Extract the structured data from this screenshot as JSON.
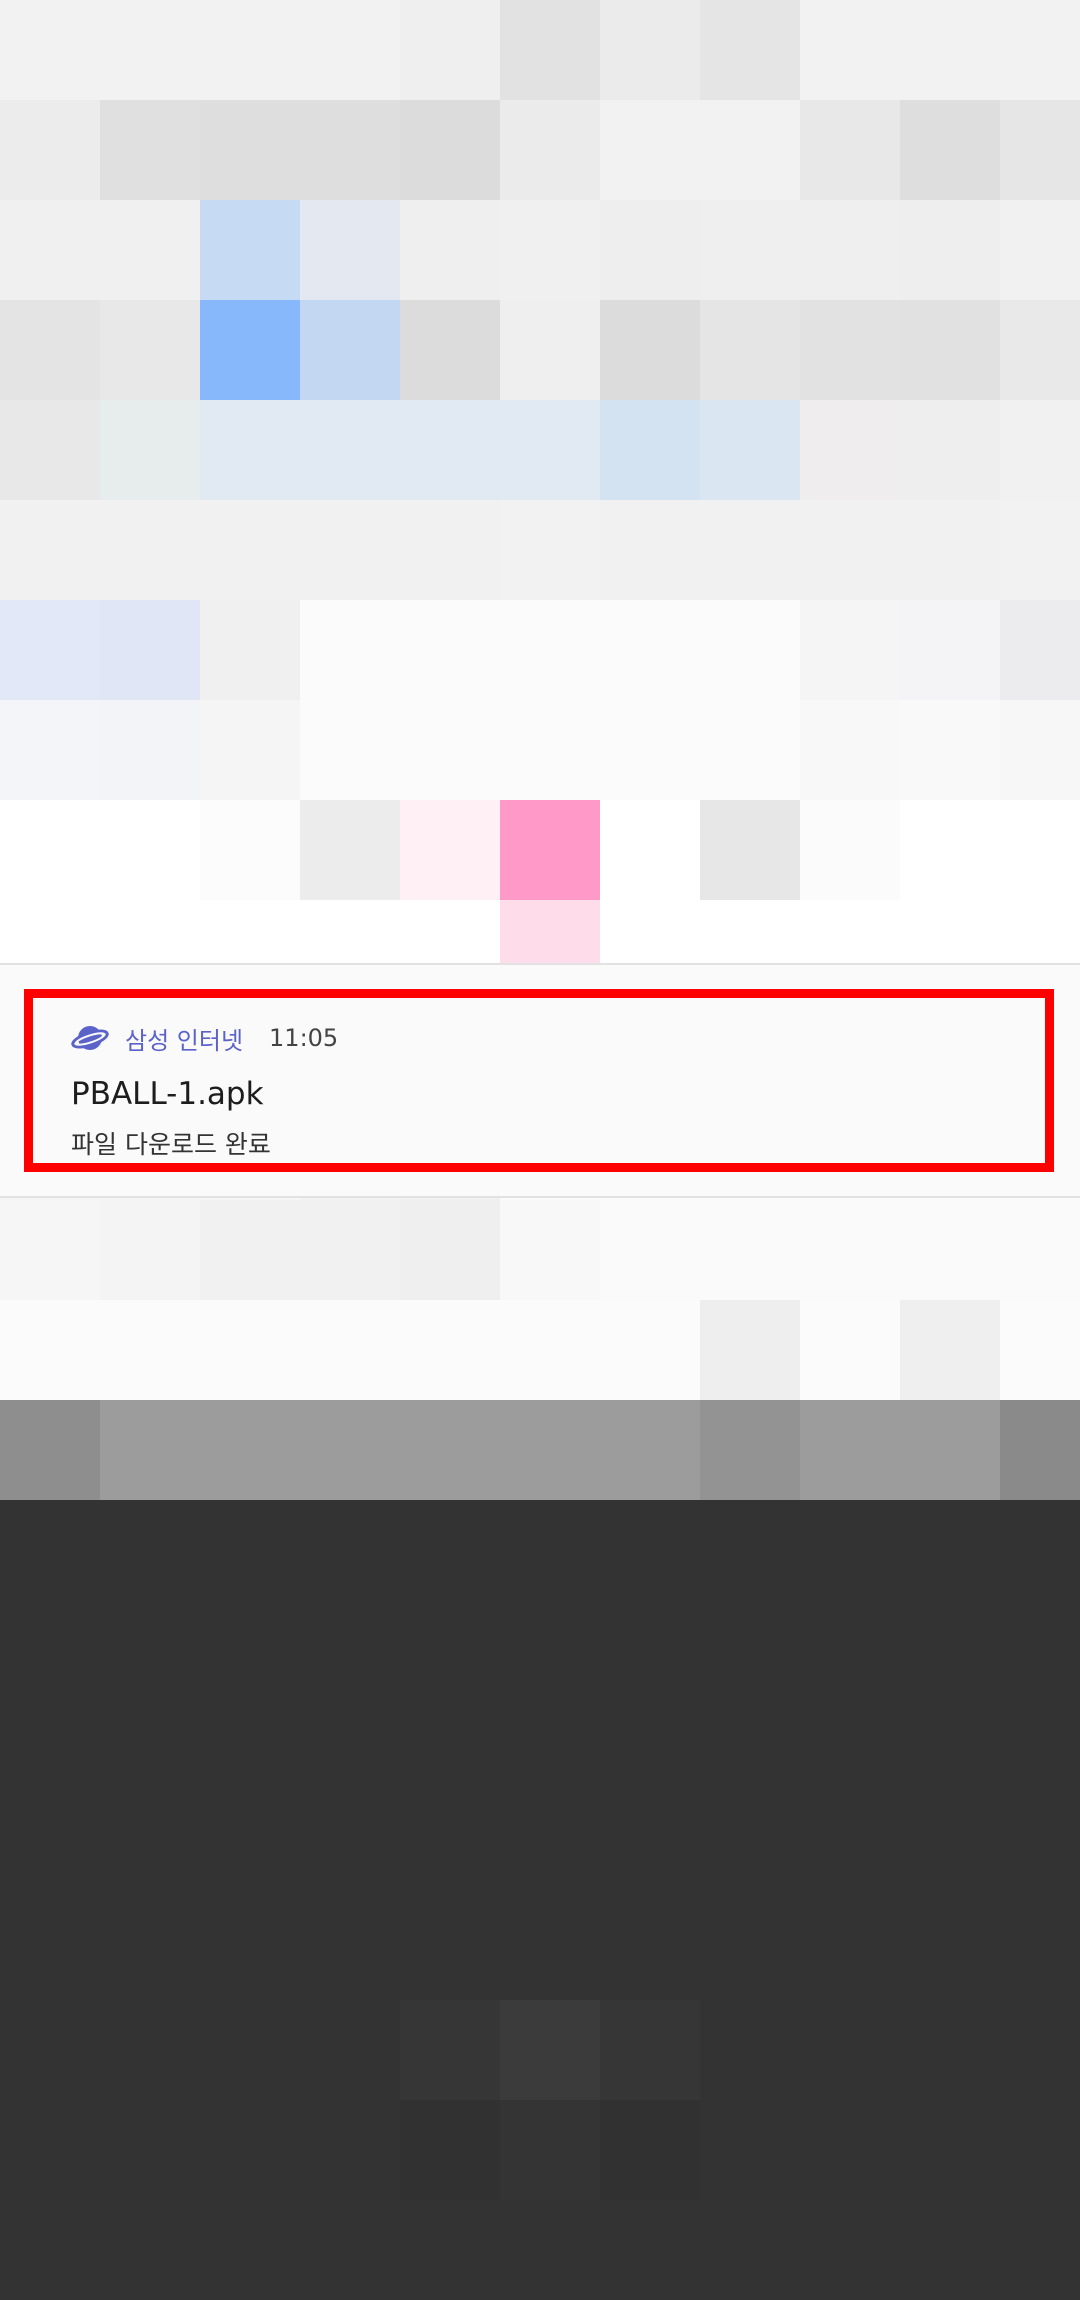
{
  "notification": {
    "app_name": "삼성 인터넷",
    "time": "11:05",
    "title": "PBALL-1.apk",
    "text": "파일 다운로드 완료",
    "app_icon": "samsung-internet-planet-icon",
    "accent_color": "#5b63c9",
    "highlight_color": "#ff0000"
  }
}
